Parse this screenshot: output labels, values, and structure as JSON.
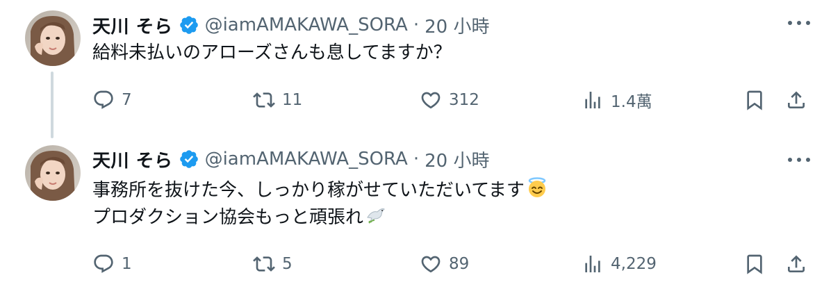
{
  "tweets": [
    {
      "display_name": "天川 そら",
      "handle": "@iamAMAKAWA_SORA",
      "separator": "·",
      "time": "20 小時",
      "text_lines": [
        "給料未払いのアローズさんも息してますか？"
      ],
      "replies": "7",
      "retweets": "11",
      "likes": "312",
      "views": "1.4萬"
    },
    {
      "display_name": "天川 そら",
      "handle": "@iamAMAKAWA_SORA",
      "separator": "·",
      "time": "20 小時",
      "text_lines": [
        "事務所を抜けた今、しっかり稼がせていただいてます",
        "プロダクション協会もっと頑張れ"
      ],
      "emoji": [
        "smiling-face-with-halo",
        "dove"
      ],
      "replies": "1",
      "retweets": "5",
      "likes": "89",
      "views": "4,229"
    }
  ],
  "colors": {
    "text": "#0f1419",
    "secondary": "#536471",
    "verified": "#1d9bf0",
    "thread_line": "#cfd9de"
  }
}
